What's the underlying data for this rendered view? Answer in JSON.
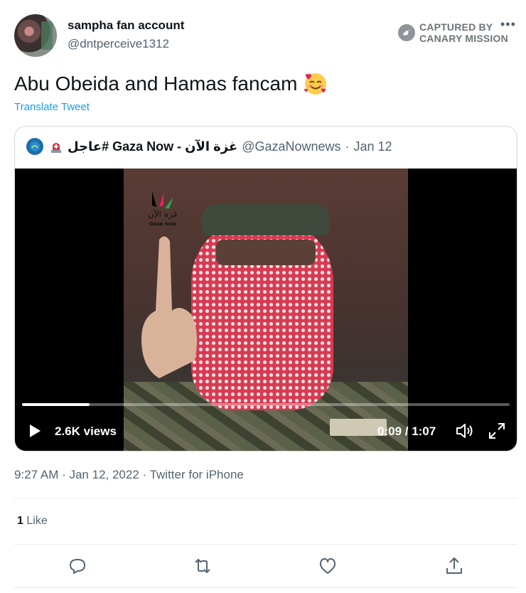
{
  "author": {
    "name": "sampha fan account",
    "handle": "@dntperceive1312"
  },
  "watermark": {
    "line1": "CAPTURED BY",
    "line2": "CANARY MISSION",
    "icon": "canary-bird-icon"
  },
  "more_icon": "•••",
  "tweet": {
    "text": "Abu Obeida and Hamas fancam",
    "emoji": "smiling-face-with-hearts",
    "translate_label": "Translate Tweet"
  },
  "quoted": {
    "account_name": "عاجل# Gaza Now - غزة الآن",
    "handle": "@GazaNownews",
    "date": "Jan 12",
    "icons": [
      "verified-avatar-icon",
      "police-light-icon"
    ]
  },
  "video": {
    "views": "2.6K views",
    "time": "0:09 / 1:07",
    "progress_fraction": 0.138,
    "logo_text": "غزة الآن",
    "logo_subtext": "Gaza now"
  },
  "meta": {
    "timestamp": "9:27 AM · Jan 12, 2022 · Twitter for iPhone"
  },
  "stats": {
    "like_count": "1",
    "like_label": "Like"
  },
  "actions": [
    "reply-icon",
    "retweet-icon",
    "like-icon",
    "share-icon"
  ],
  "colors": {
    "accent": "#1d9bf0",
    "text": "#0f1419",
    "secondary": "#536471",
    "border": "#cfd9de"
  }
}
